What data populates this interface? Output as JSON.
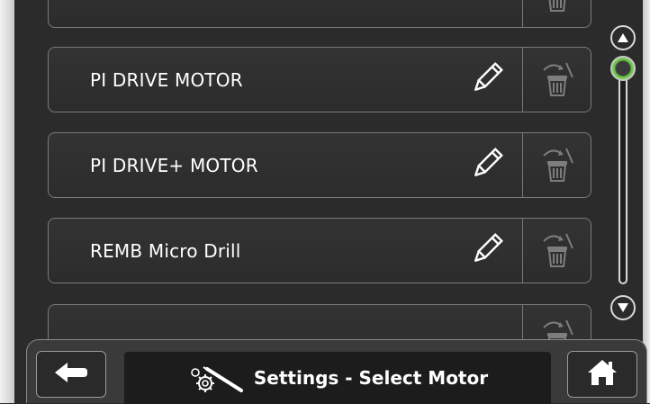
{
  "motor_list": {
    "items": [
      {
        "label": "",
        "edit_icon": "none",
        "delete_icon": "trash-icon"
      },
      {
        "label": "PI DRIVE MOTOR",
        "edit_icon": "pencil-icon",
        "delete_icon": "trash-icon"
      },
      {
        "label": "PI DRIVE+ MOTOR",
        "edit_icon": "pencil-icon",
        "delete_icon": "trash-icon"
      },
      {
        "label": "REMB Micro Drill",
        "edit_icon": "pencil-icon",
        "delete_icon": "trash-icon"
      },
      {
        "label": "",
        "edit_icon": "none",
        "delete_icon": "trash-icon"
      }
    ]
  },
  "scrollbar": {
    "up_icon": "triangle-up-icon",
    "down_icon": "triangle-down-icon",
    "thumb_color": "#7fd35a"
  },
  "footer": {
    "back_icon": "arrow-left-icon",
    "title": "Settings - Select Motor",
    "title_icon": "motor-settings-icon",
    "home_icon": "home-icon"
  },
  "colors": {
    "background": "#2b2b2b",
    "row_border": "#7a7a7a",
    "text": "#ffffff",
    "accent_green": "#7fd35a"
  }
}
